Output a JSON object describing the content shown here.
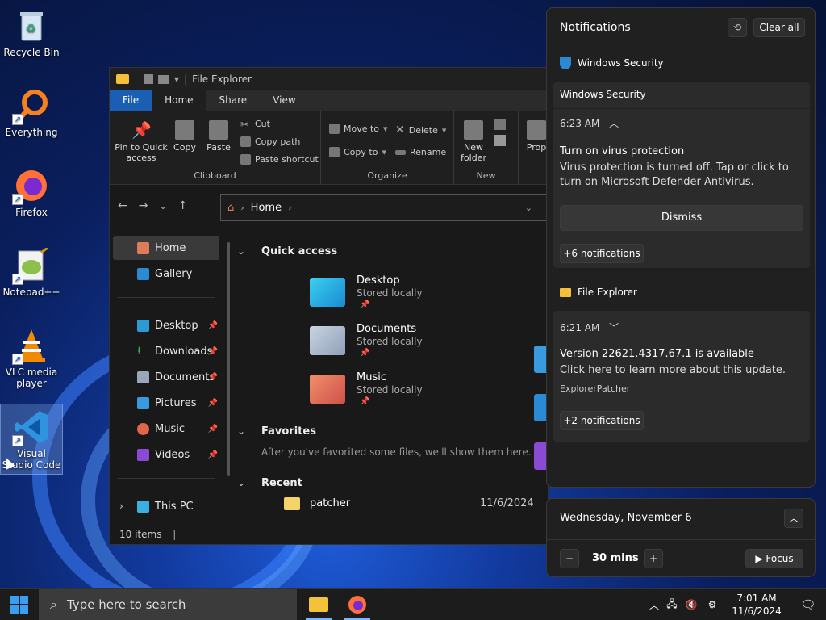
{
  "desktop": {
    "icons": [
      {
        "label": "Recycle Bin"
      },
      {
        "label": "Everything"
      },
      {
        "label": "Firefox"
      },
      {
        "label": "Notepad++"
      },
      {
        "label": "VLC media player"
      },
      {
        "label": "Visual Studio Code"
      }
    ]
  },
  "explorer": {
    "title": "File Explorer",
    "tabs": [
      "File",
      "Home",
      "Share",
      "View"
    ],
    "ribbon": {
      "pin": "Pin to Quick access",
      "copy": "Copy",
      "paste": "Paste",
      "cut": "Cut",
      "copy_path": "Copy path",
      "paste_shortcut": "Paste shortcut",
      "clipboard": "Clipboard",
      "move_to": "Move to",
      "copy_to": "Copy to",
      "delete": "Delete",
      "rename": "Rename",
      "organize": "Organize",
      "new_folder": "New folder",
      "new": "New",
      "properties": "Prop"
    },
    "address": {
      "crumb": "Home"
    },
    "nav": {
      "home": "Home",
      "gallery": "Gallery",
      "desktop": "Desktop",
      "downloads": "Downloads",
      "documents": "Documents",
      "pictures": "Pictures",
      "music": "Music",
      "videos": "Videos",
      "this_pc": "This PC"
    },
    "content": {
      "quick_access": "Quick access",
      "folders": [
        {
          "name": "Desktop",
          "status": "Stored locally"
        },
        {
          "name": "Documents",
          "status": "Stored locally"
        },
        {
          "name": "Music",
          "status": "Stored locally"
        }
      ],
      "favorites": "Favorites",
      "favorites_empty": "After you've favorited some files, we'll show them here.",
      "recent": "Recent",
      "recent_item": {
        "name": "patcher",
        "date": "11/6/2024"
      }
    },
    "status": "10 items"
  },
  "notifications": {
    "title": "Notifications",
    "clear_all": "Clear all",
    "groups": [
      {
        "app": "Windows Security",
        "header": "Windows Security",
        "time": "6:23 AM",
        "heading": "Turn on virus protection",
        "body": "Virus protection is turned off. Tap or click to turn on Microsoft Defender Antivirus.",
        "action": "Dismiss",
        "more": "+6 notifications"
      },
      {
        "app": "File Explorer",
        "time": "6:21 AM",
        "heading": "Version 22621.4317.67.1 is available",
        "body": "Click here to learn more about this update.",
        "source": "ExplorerPatcher",
        "more": "+2 notifications"
      }
    ]
  },
  "calendar": {
    "date": "Wednesday, November 6",
    "focus_duration": "30 mins",
    "focus_label": "Focus"
  },
  "taskbar": {
    "search_placeholder": "Type here to search",
    "time": "7:01 AM",
    "date": "11/6/2024"
  },
  "colors": {
    "accent": "#1a5fb4",
    "wallpaper": "#123a9e"
  }
}
